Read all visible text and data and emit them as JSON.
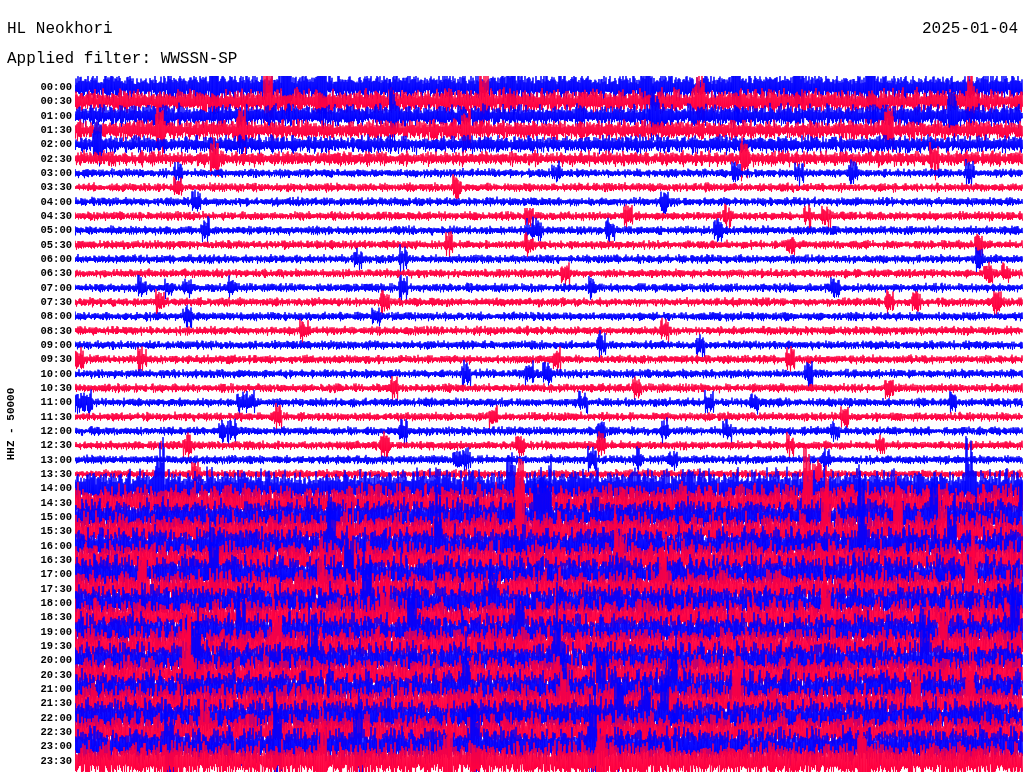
{
  "station": "HL Neokhori",
  "date": "2025-01-04",
  "filter": "Applied filter: WWSSN-SP",
  "channel": "HHZ - 50000",
  "rows": [
    {
      "time": "00:00"
    },
    {
      "time": "00:30"
    },
    {
      "time": "01:00"
    },
    {
      "time": "01:30"
    },
    {
      "time": "02:00"
    },
    {
      "time": "02:30"
    },
    {
      "time": "03:00"
    },
    {
      "time": "03:30"
    },
    {
      "time": "04:00"
    },
    {
      "time": "04:30"
    },
    {
      "time": "05:00"
    },
    {
      "time": "05:30"
    },
    {
      "time": "06:00"
    },
    {
      "time": "06:30"
    },
    {
      "time": "07:00"
    },
    {
      "time": "07:30"
    },
    {
      "time": "08:00"
    },
    {
      "time": "08:30"
    },
    {
      "time": "09:00"
    },
    {
      "time": "09:30"
    },
    {
      "time": "10:00"
    },
    {
      "time": "10:30"
    },
    {
      "time": "11:00"
    },
    {
      "time": "11:30"
    },
    {
      "time": "12:00"
    },
    {
      "time": "12:30"
    },
    {
      "time": "13:00"
    },
    {
      "time": "13:30"
    },
    {
      "time": "14:00"
    },
    {
      "time": "14:30"
    },
    {
      "time": "15:00"
    },
    {
      "time": "15:30"
    },
    {
      "time": "16:00"
    },
    {
      "time": "16:30"
    },
    {
      "time": "17:00"
    },
    {
      "time": "17:30"
    },
    {
      "time": "18:00"
    },
    {
      "time": "18:30"
    },
    {
      "time": "19:00"
    },
    {
      "time": "19:30"
    },
    {
      "time": "20:00"
    },
    {
      "time": "20:30"
    },
    {
      "time": "21:00"
    },
    {
      "time": "21:30"
    },
    {
      "time": "22:00"
    },
    {
      "time": "22:30"
    },
    {
      "time": "23:00"
    },
    {
      "time": "23:30"
    }
  ]
}
